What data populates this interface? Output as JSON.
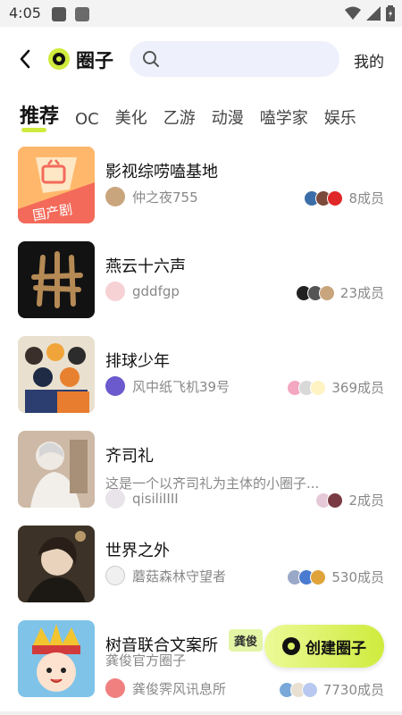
{
  "status_bar": {
    "time": "4:05"
  },
  "header": {
    "title": "圈子",
    "search_placeholder": "",
    "mine_label": "我的"
  },
  "tabs": [
    {
      "label": "推荐",
      "active": true
    },
    {
      "label": "OC"
    },
    {
      "label": "美化"
    },
    {
      "label": "乙游"
    },
    {
      "label": "动漫"
    },
    {
      "label": "嗑学家"
    },
    {
      "label": "娱乐"
    }
  ],
  "circles": [
    {
      "name": "影视综唠嗑基地",
      "owner": "仲之夜755",
      "members": "8成员"
    },
    {
      "name": "燕云十六声",
      "owner": "gddfgp",
      "members": "23成员"
    },
    {
      "name": "排球少年",
      "owner": "风中纸飞机39号",
      "members": "369成员"
    },
    {
      "name": "齐司礼",
      "description": "这是一个以齐司礼为主体的小圈子...",
      "owner": "qisiliIIII",
      "members": "2成员"
    },
    {
      "name": "世界之外",
      "owner": "蘑菇森林守望者",
      "members": "530成员"
    },
    {
      "name": "树音联合文案所",
      "tag": "龚俊",
      "description": "龚俊官方圈子",
      "owner": "龚俊霁风讯息所",
      "members": "7730成员"
    }
  ],
  "thumb_labels": {
    "tv": "国产剧"
  },
  "create_button": {
    "label": "创建圈子"
  },
  "colors": {
    "accent": "#cfeb3d",
    "search_bg": "#eef0fb",
    "muted_text": "#888888"
  }
}
